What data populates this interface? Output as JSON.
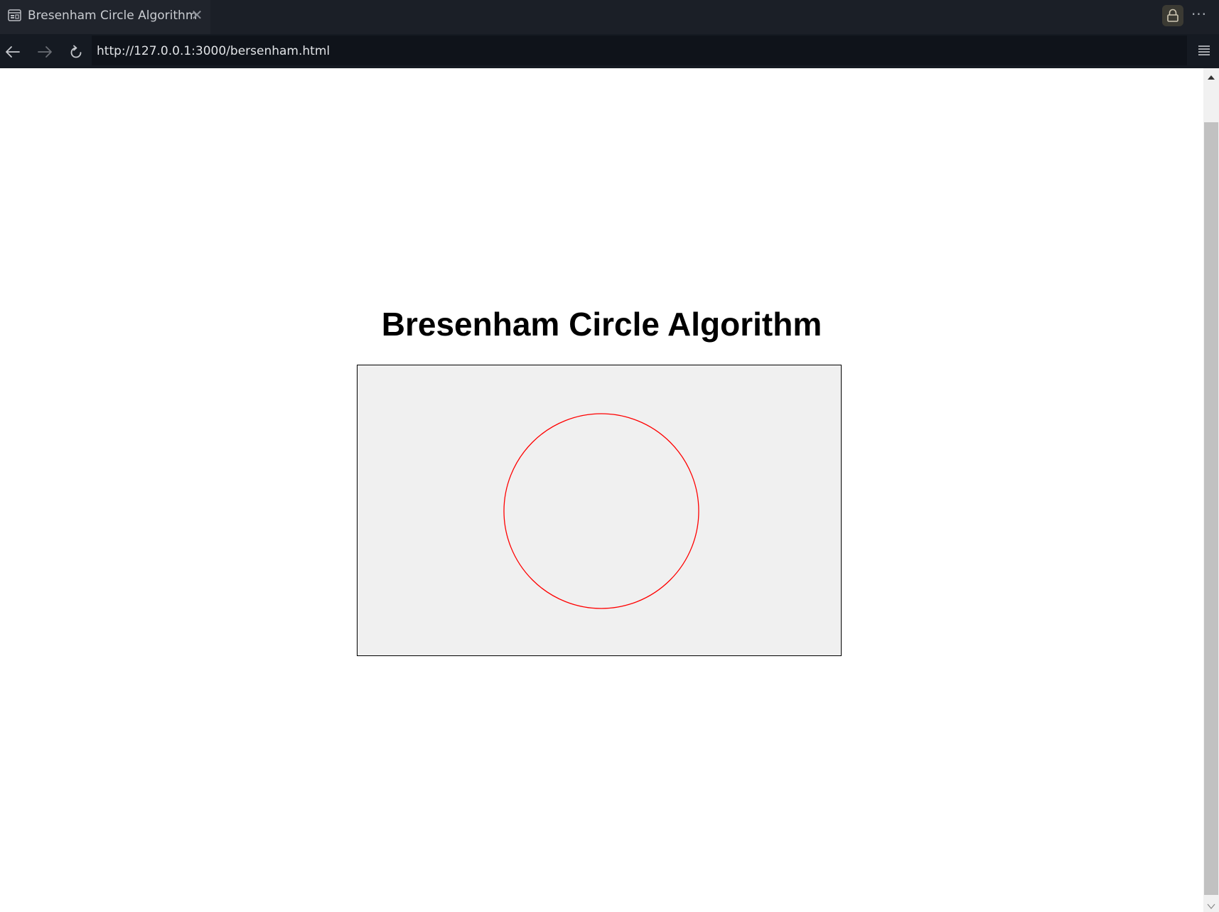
{
  "browser": {
    "tab_title": "Bresenham Circle Algorithm",
    "close_glyph": "✕",
    "more_glyph": "···",
    "url": "http://127.0.0.1:3000/bersenham.html",
    "icons": [
      "page-icon",
      "close-icon",
      "lock-icon",
      "more-icon",
      "back-icon",
      "forward-icon",
      "reload-icon",
      "menu-icon"
    ]
  },
  "page": {
    "title": "Bresenham Circle Algorithm",
    "canvas": {
      "background": "#f0f0f0",
      "border_color": "#000000",
      "circle_color": "#ff0000",
      "circle_fill": "none"
    }
  },
  "colors": {
    "chrome_tabbar": "#1b1f27",
    "chrome_toolbar": "#151a22",
    "page_bg": "#ffffff"
  }
}
